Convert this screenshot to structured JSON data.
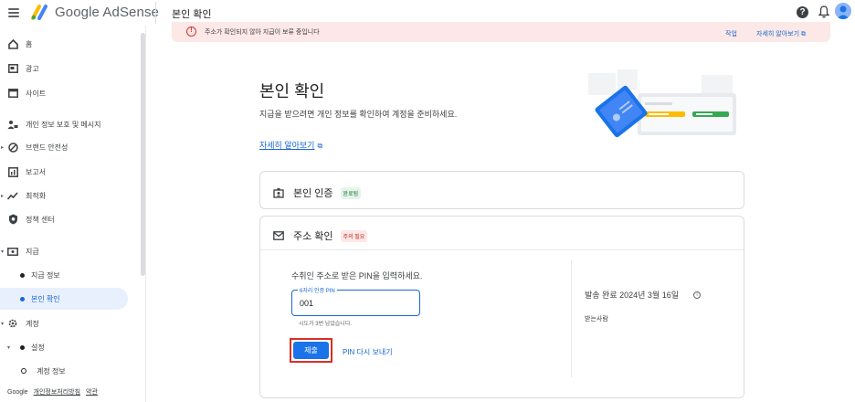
{
  "header": {
    "app_name": "Google AdSense",
    "page_title": "본인 확인",
    "help_icon": "help-icon",
    "notification_icon": "bell-icon"
  },
  "banner": {
    "message": "주소가 확인되지 않아 지급이 보류 중입니다",
    "action_primary": "작업",
    "action_secondary": "자세히 알아보기",
    "color": "#fce8e6"
  },
  "sidebar": {
    "items": [
      {
        "label": "홈",
        "icon": "home-icon"
      },
      {
        "label": "광고",
        "icon": "ads-icon"
      },
      {
        "label": "사이트",
        "icon": "sites-icon"
      },
      {
        "label": "개인 정보 보호 및 메시지",
        "icon": "privacy-icon"
      },
      {
        "label": "브랜드 안전성",
        "icon": "brand-safety-icon"
      },
      {
        "label": "보고서",
        "icon": "reports-icon"
      },
      {
        "label": "최적화",
        "icon": "optimization-icon"
      },
      {
        "label": "정책 센터",
        "icon": "policy-center-icon"
      },
      {
        "label": "지급",
        "icon": "payments-icon"
      },
      {
        "label": "지급 정보",
        "icon": "dot-icon"
      },
      {
        "label": "본인 확인",
        "icon": "dot-icon"
      },
      {
        "label": "계정",
        "icon": "account-icon"
      },
      {
        "label": "설정",
        "icon": "dot-icon"
      },
      {
        "label": "계정 정보",
        "icon": "ring-icon"
      }
    ],
    "footer": {
      "brand": "Google",
      "privacy_link": "개인정보처리방침",
      "terms_link": "약관"
    }
  },
  "main": {
    "title": "본인 확인",
    "description": "지급을 받으려면 개인 정보를 확인하여 계정을 준비하세요.",
    "learn_more": "자세히 알아보기",
    "identity_card": {
      "title": "본인 인증",
      "badge": "완료됨"
    },
    "address_card": {
      "title": "주소 확인",
      "badge": "주의 필요",
      "pin_prompt": "수취인 주소로 받은 PIN을 입력하세요.",
      "pin_label": "6자리 인증 PIN",
      "pin_value": "001",
      "pin_helper": "시도가 3번 남았습니다.",
      "submit_label": "제출",
      "resend_label": "PIN 다시 보내기",
      "sent_info": "발송 완료 2024년 3월 16일",
      "recipient_label": "받는사람"
    }
  },
  "colors": {
    "accent": "#1a73e8",
    "success": "#137333",
    "error": "#d93025"
  }
}
